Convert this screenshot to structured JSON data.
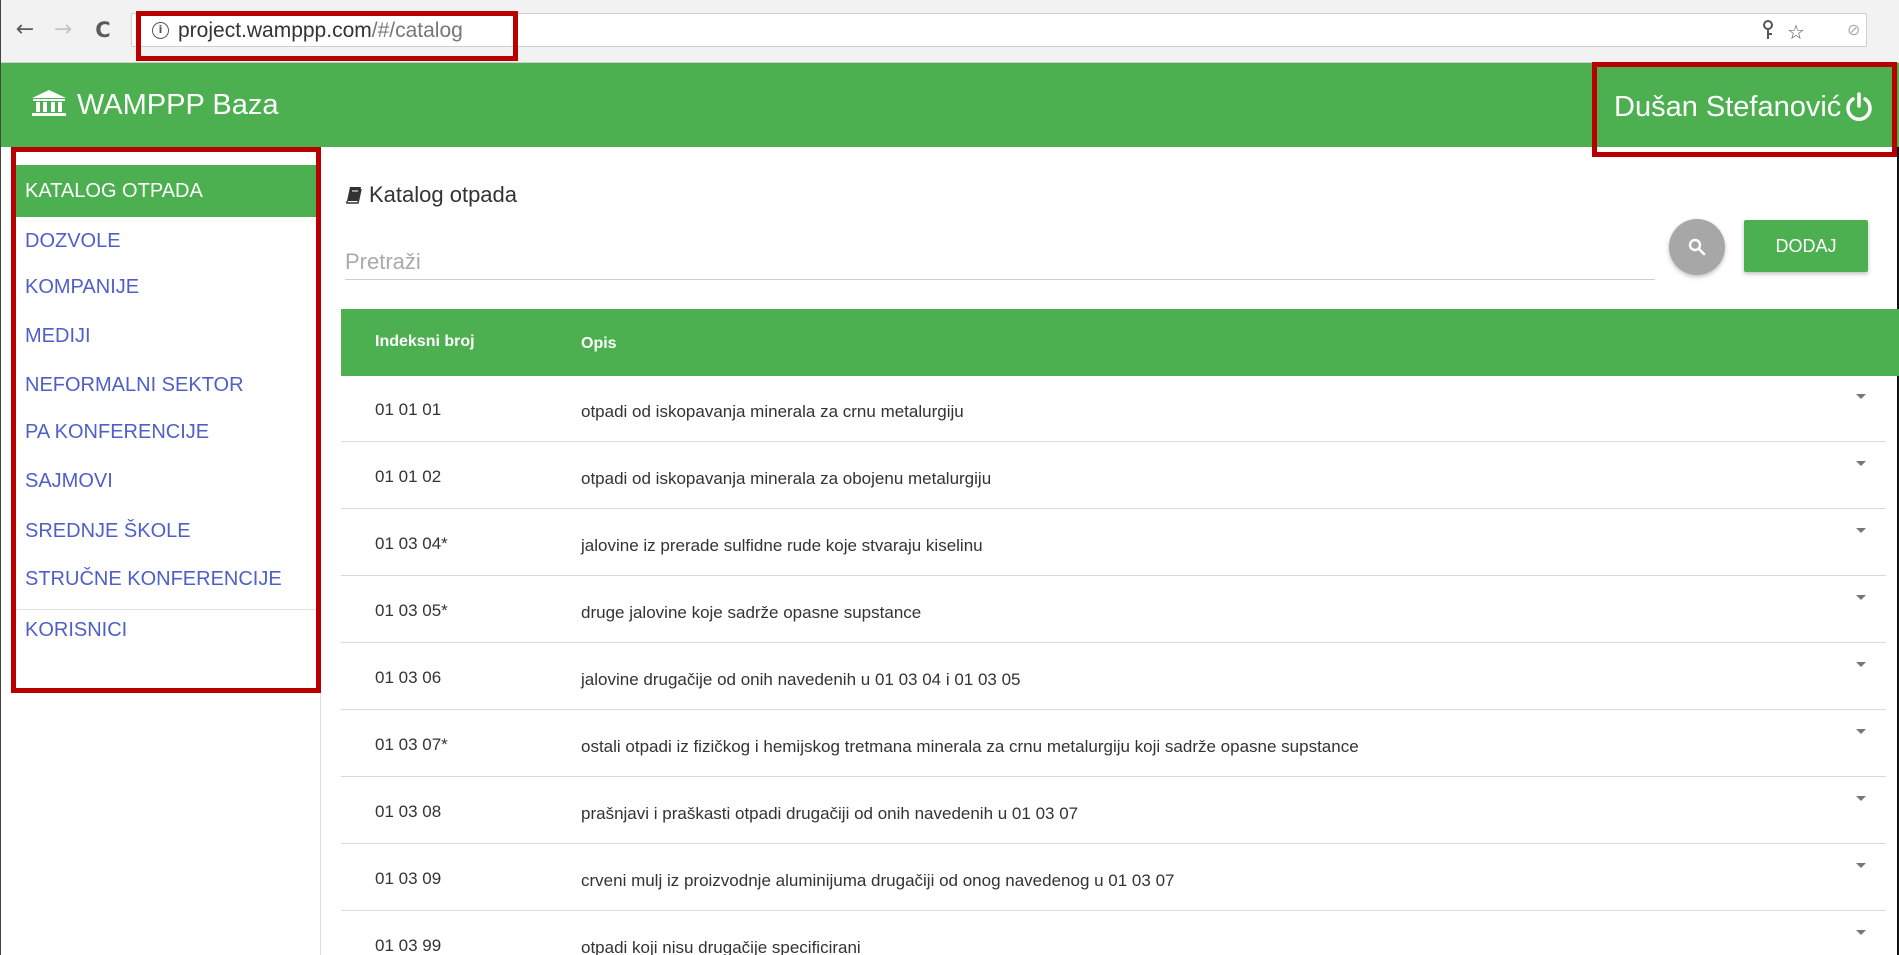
{
  "browser": {
    "back": "←",
    "forward": "→",
    "reload": "C",
    "info": "i",
    "url_host": "project.wamppp.com",
    "url_path": "/#/catalog",
    "key_icon": "key-icon",
    "star": "☆",
    "ext": "⊘"
  },
  "header": {
    "brand": "WAMPPP Baza",
    "user_name": "Dušan Stefanović"
  },
  "sidebar": {
    "items": [
      {
        "label": "KATALOG OTPADA",
        "active": true
      },
      {
        "label": "DOZVOLE"
      },
      {
        "label": "KOMPANIJE"
      },
      {
        "label": "MEDIJI"
      },
      {
        "label": "NEFORMALNI SEKTOR"
      },
      {
        "label": "PA KONFERENCIJE"
      },
      {
        "label": "SAJMOVI"
      },
      {
        "label": "SREDNJE ŠKOLE"
      },
      {
        "label": "STRUČNE KONFERENCIJE"
      },
      {
        "label": "KORISNICI"
      }
    ]
  },
  "main": {
    "title": "Katalog otpada",
    "search_placeholder": "Pretraži",
    "add_label": "DODAJ",
    "columns": {
      "index": "Indeksni broj",
      "desc": "Opis"
    },
    "rows": [
      {
        "index": "01 01 01",
        "desc": "otpadi od iskopavanja minerala za crnu metalurgiju"
      },
      {
        "index": "01 01 02",
        "desc": "otpadi od iskopavanja minerala za obojenu metalurgiju"
      },
      {
        "index": "01 03 04*",
        "desc": "jalovine iz prerade sulfidne rude koje stvaraju kiselinu"
      },
      {
        "index": "01 03 05*",
        "desc": "druge jalovine koje sadrže opasne supstance"
      },
      {
        "index": "01 03 06",
        "desc": "jalovine drugačije od onih navedenih u 01 03 04 i 01 03 05"
      },
      {
        "index": "01 03 07*",
        "desc": "ostali otpadi iz fizičkog i hemijskog tretmana minerala za crnu metalurgiju koji sadrže opasne supstance"
      },
      {
        "index": "01 03 08",
        "desc": "prašnjavi i praškasti otpadi drugačiji od onih navedenih u 01 03 07"
      },
      {
        "index": "01 03 09",
        "desc": "crveni mulj iz proizvodnje aluminijuma drugačiji od onog navedenog u 01 03 07"
      },
      {
        "index": "01 03 99",
        "desc": "otpadi koji nisu drugačije specificirani"
      }
    ]
  },
  "colors": {
    "primary": "#4caf50",
    "nav_link": "#4f5fc9",
    "highlight": "#b80000"
  }
}
